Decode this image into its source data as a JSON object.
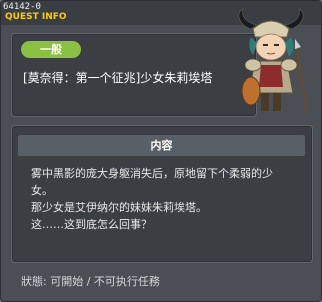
{
  "window": {
    "quest_id": "64142-0",
    "title": "QUEST INFO"
  },
  "quest": {
    "category": "一般",
    "name": "[莫奈得：第一个征兆]少女朱莉埃塔"
  },
  "content": {
    "header": "内容",
    "lines": [
      "雾中黑影的庞大身躯消失后，原地留下个柔弱的少",
      "女。",
      "那少女是艾伊纳尔的妹妹朱莉埃塔。",
      "这……这到底怎么回事？"
    ]
  },
  "status": {
    "text": "狀態:  可開始  /  不可执行任務"
  },
  "colors": {
    "title": "#ffcc00",
    "badge": "#8bc142",
    "window_bg": "#4a4f55",
    "panel_bg": "#3b3f44"
  }
}
